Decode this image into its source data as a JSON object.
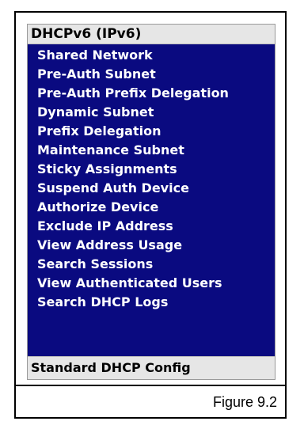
{
  "menu": {
    "header": "DHCPv6 (IPv6)",
    "items": [
      "Shared Network",
      "Pre-Auth Subnet",
      "Pre-Auth Prefix Delegation",
      "Dynamic Subnet",
      "Prefix Delegation",
      "Maintenance Subnet",
      "Sticky Assignments",
      "Suspend Auth Device",
      "Authorize Device",
      "Exclude IP Address",
      "View Address Usage",
      "Search Sessions",
      "View Authenticated Users",
      "Search DHCP Logs"
    ],
    "footer": "Standard DHCP Config"
  },
  "caption": "Figure 9.2",
  "colors": {
    "menu_background": "#0a0a80",
    "header_background": "#e6e6e6",
    "item_text": "#ffffff"
  }
}
